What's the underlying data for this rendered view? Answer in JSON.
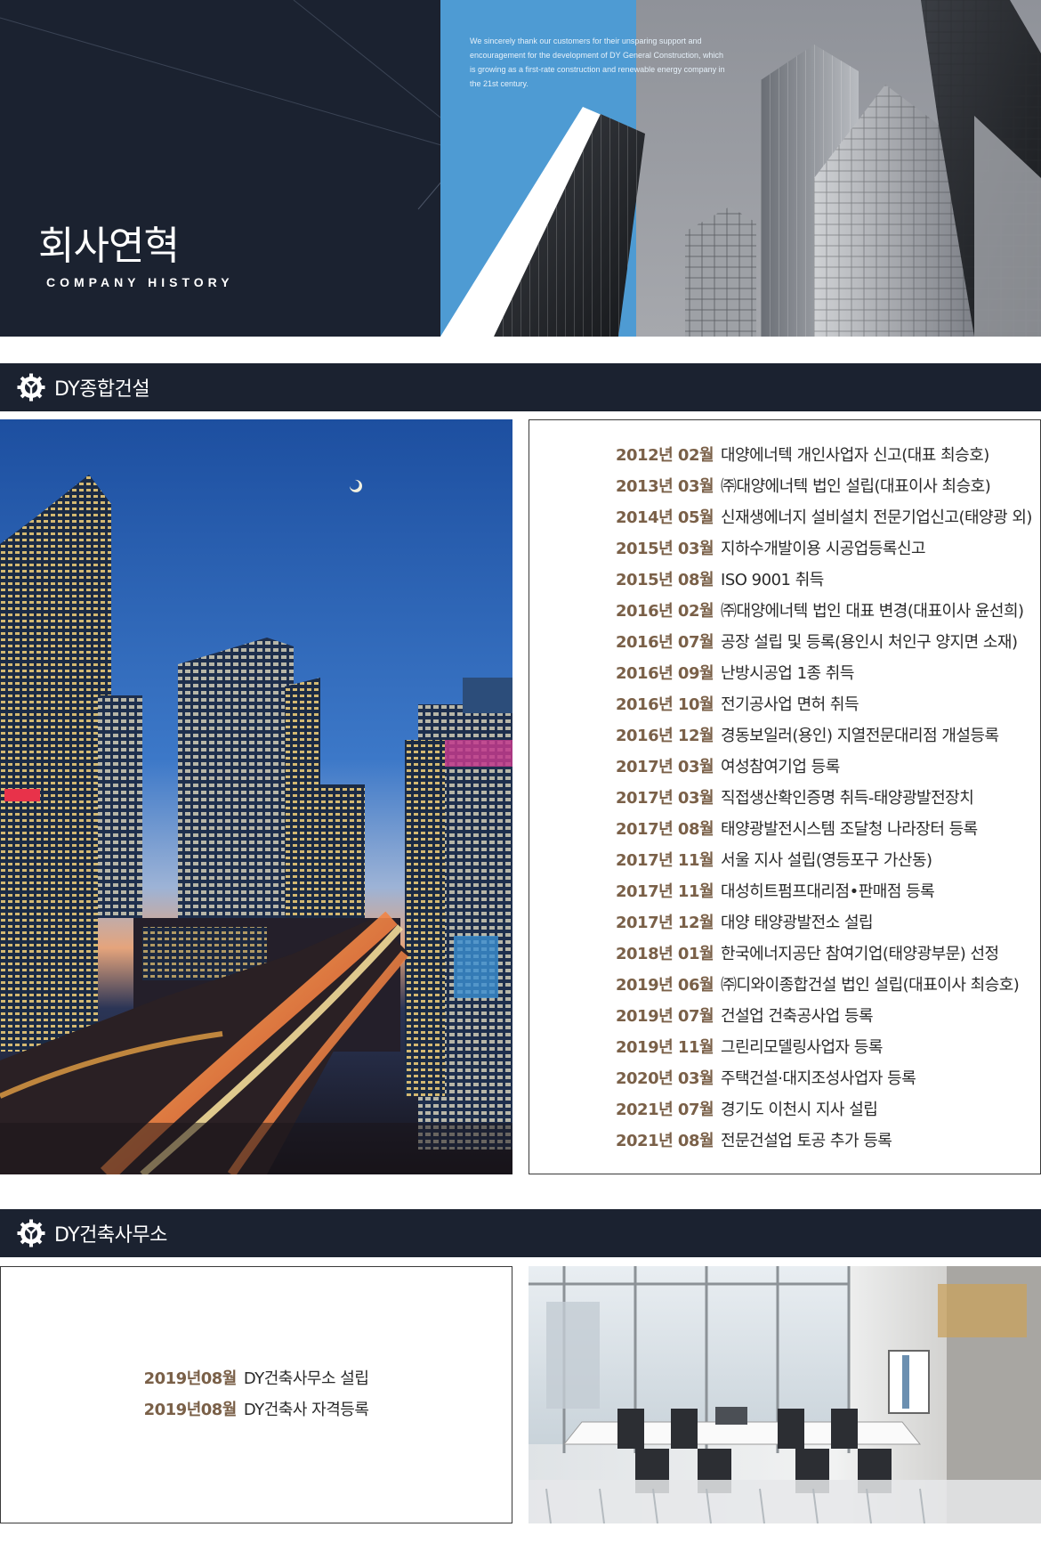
{
  "hero": {
    "title": "회사연혁",
    "subtitle": "COMPANY HISTORY",
    "caption": "We sincerely thank our customers for their unsparing support and encouragement for the development of DY General Construction, which is growing as a first-rate construction and renewable energy company in the 21st century."
  },
  "sections": [
    {
      "title": "DY종합건설",
      "items": [
        {
          "date": "2012년 02월",
          "text": "대양에너텍 개인사업자 신고(대표 최승호)"
        },
        {
          "date": "2013년 03월",
          "text": "㈜대양에너텍 법인 설립(대표이사 최승호)"
        },
        {
          "date": "2014년 05월",
          "text": "신재생에너지 설비설치 전문기업신고(태양광 외)"
        },
        {
          "date": "2015년 03월",
          "text": "지하수개발이용 시공업등록신고"
        },
        {
          "date": "2015년 08월",
          "text": "ISO 9001 취득"
        },
        {
          "date": "2016년 02월",
          "text": "㈜대양에너텍 법인 대표 변경(대표이사 윤선희)"
        },
        {
          "date": "2016년 07월",
          "text": "공장 설립 및 등록(용인시 처인구 양지면 소재)"
        },
        {
          "date": "2016년 09월",
          "text": "난방시공업 1종 취득"
        },
        {
          "date": "2016년 10월",
          "text": "전기공사업 면허 취득"
        },
        {
          "date": "2016년 12월",
          "text": "경동보일러(용인) 지열전문대리점 개설등록"
        },
        {
          "date": "2017년 03월",
          "text": "여성참여기업 등록"
        },
        {
          "date": "2017년 03월",
          "text": "직접생산확인증명 취득-태양광발전장치"
        },
        {
          "date": "2017년 08월",
          "text": "태양광발전시스템 조달청 나라장터 등록"
        },
        {
          "date": "2017년 11월",
          "text": "서울 지사 설립(영등포구 가산동)"
        },
        {
          "date": "2017년 11월",
          "text": "대성히트펌프대리점•판매점 등록"
        },
        {
          "date": "2017년 12월",
          "text": "대양 태양광발전소 설립"
        },
        {
          "date": "2018년 01월",
          "text": "한국에너지공단 참여기업(태양광부문) 선정"
        },
        {
          "date": "2019년 06월",
          "text": "㈜디와이종합건설 법인 설립(대표이사 최승호)"
        },
        {
          "date": "2019년 07월",
          "text": "건설업 건축공사업 등록"
        },
        {
          "date": "2019년 11월",
          "text": "그린리모델링사업자 등록"
        },
        {
          "date": "2020년 03월",
          "text": "주택건설·대지조성사업자 등록"
        },
        {
          "date": "2021년 07월",
          "text": "경기도 이천시 지사 설립"
        },
        {
          "date": "2021년 08월",
          "text": "전문건설업 토공 추가 등록"
        }
      ]
    },
    {
      "title": "DY건축사무소",
      "items": [
        {
          "date": "2019년08월",
          "text": "DY건축사무소 설립"
        },
        {
          "date": "2019년08월",
          "text": "DY건축사 자격등록"
        }
      ]
    }
  ],
  "icons": {
    "bar": "gear-logo-icon"
  },
  "colors": {
    "navy": "#1b2230",
    "date": "#7a6048",
    "accent_blue": "#4e9bd3"
  }
}
